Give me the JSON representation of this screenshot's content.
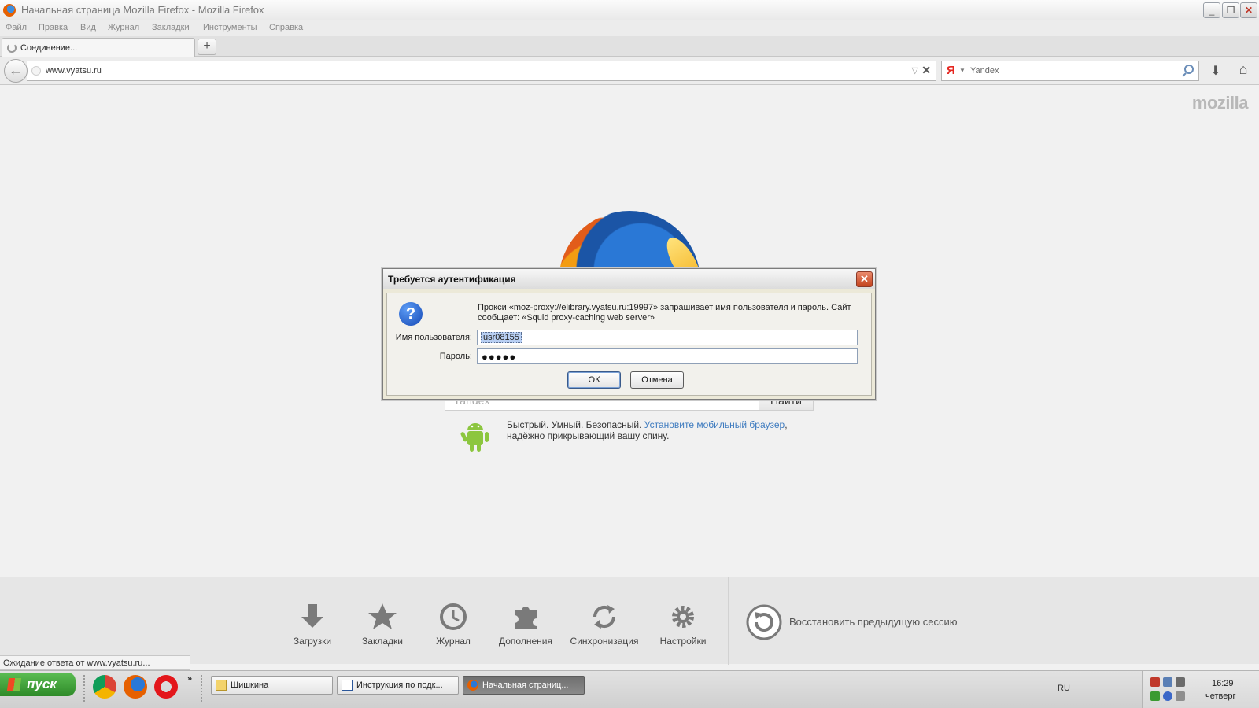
{
  "window": {
    "title": "Начальная страница Mozilla Firefox - Mozilla Firefox",
    "minimize": "_",
    "maximize": "❐",
    "close": "✕"
  },
  "menu": [
    "Файл",
    "Правка",
    "Вид",
    "Журнал",
    "Закладки",
    "Инструменты",
    "Справка"
  ],
  "tab": {
    "label": "Соединение...",
    "new_tab": "+"
  },
  "nav": {
    "back": "←",
    "url": "www.vyatsu.ru",
    "url_drop": "▽",
    "stop": "✕",
    "search_engine": "Я",
    "search_engine_drop": "▼",
    "search_placeholder": "Yandex",
    "downloads": "⬇",
    "home": "⌂"
  },
  "content": {
    "brand": "mozilla",
    "search_placeholder": "Yandex",
    "search_button": "Найти",
    "promo_text": "Быстрый. Умный. Безопасный.",
    "promo_link": "Установите мобильный браузер",
    "promo_comma": ",",
    "promo_line2": "надёжно прикрывающий вашу спину."
  },
  "launcher": {
    "items": [
      {
        "label": "Загрузки",
        "icon": "download-icon"
      },
      {
        "label": "Закладки",
        "icon": "bookmark-star-icon"
      },
      {
        "label": "Журнал",
        "icon": "history-clock-icon"
      },
      {
        "label": "Дополнения",
        "icon": "addons-puzzle-icon"
      },
      {
        "label": "Синхронизация",
        "icon": "sync-icon"
      },
      {
        "label": "Настройки",
        "icon": "settings-gear-icon"
      }
    ],
    "restore_label": "Восстановить предыдущую сессию"
  },
  "status": "Ожидание ответа от www.vyatsu.ru...",
  "dialog": {
    "title": "Требуется аутентификация",
    "close": "✕",
    "icon_glyph": "?",
    "message": "Прокси «moz-proxy://elibrary.vyatsu.ru:19997» запрашивает имя пользователя и пароль. Сайт сообщает: «Squid proxy-caching web server»",
    "username_label": "Имя пользователя:",
    "username_value": "usr08155",
    "password_label": "Пароль:",
    "password_mask": "●●●●●",
    "ok": "ОК",
    "cancel": "Отмена"
  },
  "taskbar": {
    "start": "пуск",
    "more": "»",
    "tasks": [
      {
        "label": "Шишкина",
        "icon": "folder-icon"
      },
      {
        "label": "Инструкция по подк...",
        "icon": "word-doc-icon"
      },
      {
        "label": "Начальная страниц...",
        "icon": "firefox-icon"
      }
    ],
    "language": "RU",
    "time": "16:29",
    "day": "четверг"
  },
  "colors": {
    "link": "#3e7bbf",
    "start_green": "#3a9a31",
    "dialog_close_red": "#c3431e"
  }
}
